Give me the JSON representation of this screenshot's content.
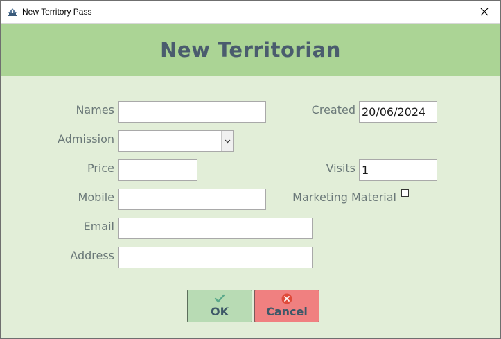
{
  "window": {
    "title": "New Territory Pass"
  },
  "banner": {
    "title": "New Territorian"
  },
  "form": {
    "names": {
      "label": "Names",
      "value": ""
    },
    "admission": {
      "label": "Admission",
      "value": ""
    },
    "price": {
      "label": "Price",
      "value": ""
    },
    "mobile": {
      "label": "Mobile",
      "value": ""
    },
    "email": {
      "label": "Email",
      "value": ""
    },
    "address": {
      "label": "Address",
      "value": ""
    },
    "created": {
      "label": "Created",
      "value": "20/06/2024"
    },
    "visits": {
      "label": "Visits",
      "value": "1"
    },
    "marketing": {
      "label": "Marketing Material",
      "checked": false
    }
  },
  "buttons": {
    "ok": "OK",
    "cancel": "Cancel"
  },
  "icons": {
    "app": "pass-app-icon",
    "close": "close-icon",
    "ok": "checkmark-icon",
    "cancel": "x-circle-icon",
    "dropdown": "chevron-down-icon"
  },
  "colors": {
    "banner": "#abd495",
    "body": "#e2eed8",
    "ok_button": "#b8dbb4",
    "cancel_button": "#f08080",
    "title_text": "#4a5c6e",
    "label_text": "#6a7878"
  }
}
